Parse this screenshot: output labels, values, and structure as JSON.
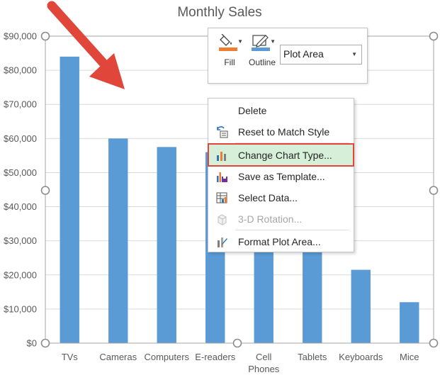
{
  "chart_data": {
    "type": "bar",
    "title": "Monthly Sales",
    "categories": [
      "TVs",
      "Cameras",
      "Computers",
      "E-readers",
      "Cell Phones",
      "Tablets",
      "Keyboards",
      "Mice"
    ],
    "category_lines": [
      [
        "TVs"
      ],
      [
        "Cameras"
      ],
      [
        "Computers"
      ],
      [
        "E-readers"
      ],
      [
        "Cell",
        "Phones"
      ],
      [
        "Tablets"
      ],
      [
        "Keyboards"
      ],
      [
        "Mice"
      ]
    ],
    "values": [
      84000,
      60000,
      57500,
      56000,
      33000,
      30000,
      21500,
      12000
    ],
    "ylim": [
      0,
      90000
    ],
    "yticks": [
      "$0",
      "$10,000",
      "$20,000",
      "$30,000",
      "$40,000",
      "$50,000",
      "$60,000",
      "$70,000",
      "$80,000",
      "$90,000"
    ],
    "grid": true,
    "bar_color": "#5b9bd5"
  },
  "mini_toolbar": {
    "fill_label": "Fill",
    "outline_label": "Outline",
    "fill_color": "#ed7d31",
    "outline_color": "#5b9bd5",
    "element_value": "Plot Area"
  },
  "context_menu": {
    "items": [
      {
        "label": "Delete",
        "icon": "none"
      },
      {
        "label": "Reset to Match Style",
        "icon": "reset-style-icon"
      },
      {
        "label": "Change Chart Type...",
        "icon": "chart-type-icon",
        "highlighted": true
      },
      {
        "label": "Save as Template...",
        "icon": "save-template-icon"
      },
      {
        "label": "Select Data...",
        "icon": "select-data-icon"
      },
      {
        "label": "3-D Rotation...",
        "icon": "rotation-3d-icon",
        "disabled": true
      },
      {
        "label": "Format Plot Area...",
        "icon": "format-area-icon"
      }
    ]
  },
  "annotation": {
    "arrow_color": "#e0463a",
    "highlight_color": "#e0463a"
  }
}
